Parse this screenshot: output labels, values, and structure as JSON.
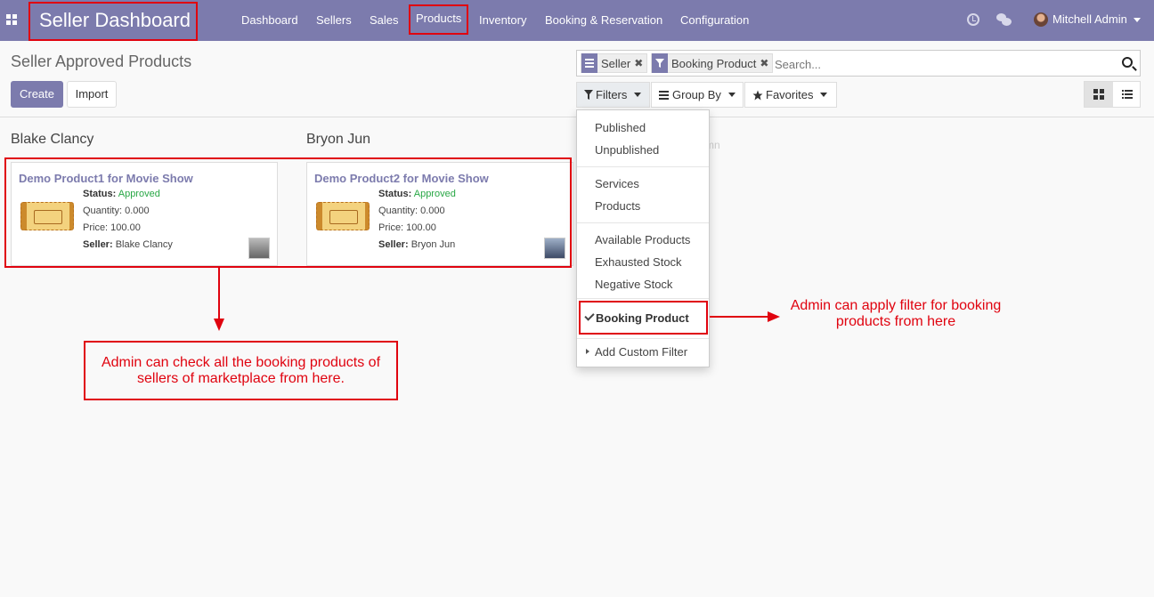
{
  "navbar": {
    "brand": "Seller Dashboard",
    "menu": [
      "Dashboard",
      "Sellers",
      "Sales",
      "Products",
      "Inventory",
      "Booking & Reservation",
      "Configuration"
    ],
    "user": "Mitchell Admin",
    "icons": [
      "apps-icon",
      "clock-icon",
      "chat-icon",
      "user-avatar",
      "chevron-down-icon"
    ]
  },
  "control_panel": {
    "title": "Seller Approved Products",
    "create_label": "Create",
    "import_label": "Import",
    "facets": [
      "Seller",
      "Booking Product"
    ],
    "search_placeholder": "Search...",
    "filters_label": "Filters",
    "groupby_label": "Group By",
    "favorites_label": "Favorites"
  },
  "filters_dropdown": {
    "group1": [
      "Published",
      "Unpublished"
    ],
    "group2": [
      "Services",
      "Products"
    ],
    "group3": [
      "Available Products",
      "Exhausted Stock",
      "Negative Stock"
    ],
    "selected": "Booking Product",
    "custom": "Add Custom Filter"
  },
  "kanban": {
    "columns": [
      {
        "title": "Blake Clancy",
        "card": {
          "name": "Demo Product1 for Movie Show",
          "status_label": "Status:",
          "status": "Approved",
          "quantity": "Quantity: 0.000",
          "price": "Price: 100.00",
          "seller_label": "Seller:",
          "seller": "Blake Clancy"
        }
      },
      {
        "title": "Bryon Jun",
        "card": {
          "name": "Demo Product2 for Movie Show",
          "status_label": "Status:",
          "status": "Approved",
          "quantity": "Quantity: 0.000",
          "price": "Price: 100.00",
          "seller_label": "Seller:",
          "seller": "Bryon Jun"
        }
      }
    ],
    "ghost_column": "mn"
  },
  "annotations": {
    "left_note": "Admin can check all the booking products of sellers of marketplace from here.",
    "right_note": "Admin can apply filter for booking products from here"
  },
  "colors": {
    "primary": "#7c7bad",
    "annotation": "#e0030f",
    "approved": "#28a745"
  }
}
